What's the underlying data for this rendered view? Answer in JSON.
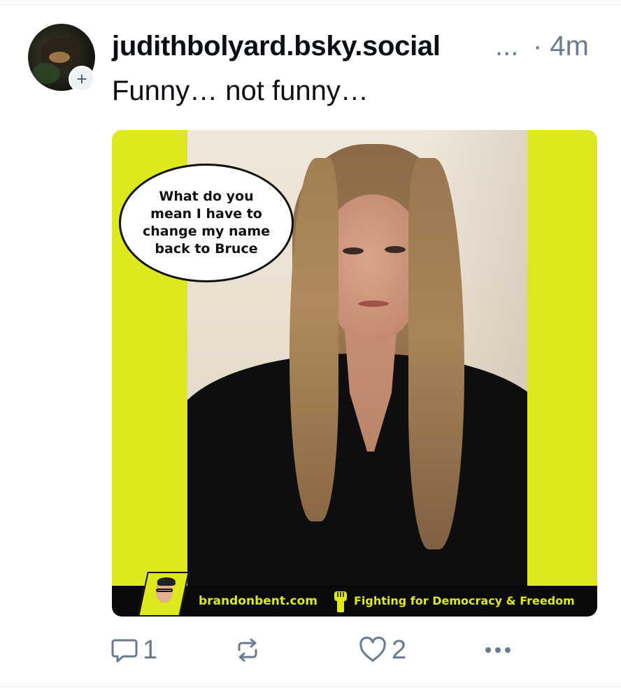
{
  "post": {
    "author_handle": "judithbolyard.bsky.social",
    "handle_overflow": "...",
    "timestamp": "· 4m",
    "text": "Funny… not funny…",
    "avatar_follow_symbol": "+"
  },
  "embed_image": {
    "speech_bubble": "What do you mean I have to change my name back to Bruce",
    "footer_site": "brandonbent.com",
    "footer_slogan": "Fighting for Democracy & Freedom",
    "accent_color": "#dde91c"
  },
  "actions": {
    "reply_count": "1",
    "repost_count": "",
    "like_count": "2",
    "icons": [
      "reply-icon",
      "repost-icon",
      "like-icon",
      "more-icon"
    ]
  },
  "colors": {
    "text_primary": "#0b0f14",
    "text_secondary": "#6b7a8c",
    "divider": "#e6e9ee"
  }
}
